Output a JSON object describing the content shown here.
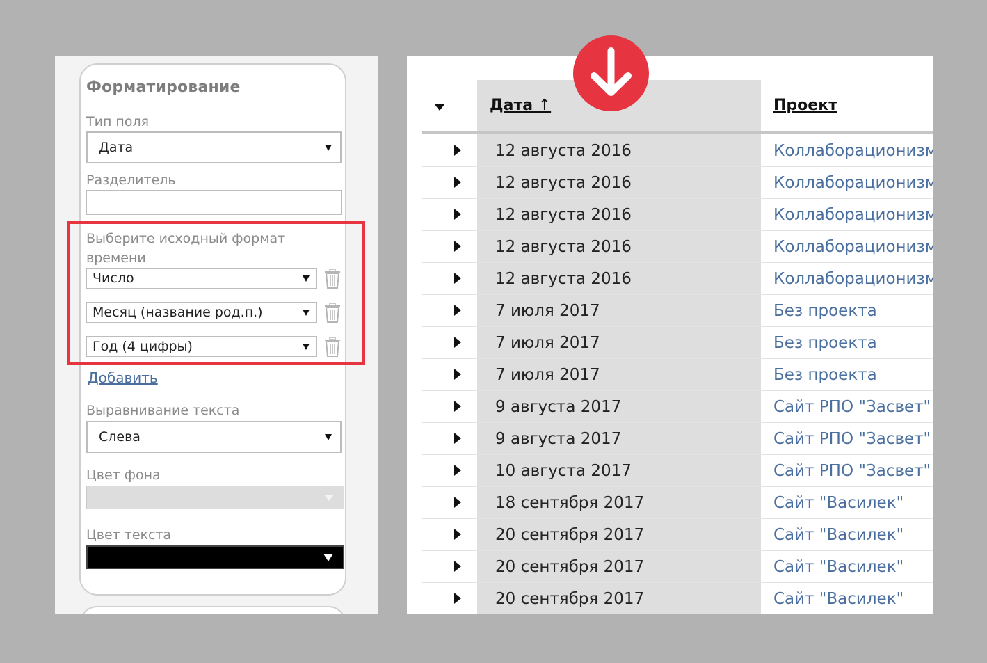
{
  "formatting": {
    "title": "Форматирование",
    "field_type": {
      "label": "Тип поля",
      "value": "Дата"
    },
    "separator": {
      "label": "Разделитель",
      "value": ""
    },
    "source_format": {
      "label_line1": "Выберите исходный формат",
      "label_line2": "времени",
      "parts": [
        {
          "value": "Число"
        },
        {
          "value": "Месяц (название род.п.)"
        },
        {
          "value": "Год (4 цифры)"
        }
      ]
    },
    "add_link": "Добавить",
    "text_align": {
      "label": "Выравнивание текста",
      "value": "Слева"
    },
    "bg_color": {
      "label": "Цвет фона",
      "value": "#dddddd"
    },
    "text_color": {
      "label": "Цвет текста",
      "value": "#000000"
    }
  },
  "table": {
    "columns": {
      "date": "Дата",
      "date_sort": "↑",
      "project": "Проект"
    },
    "rows": [
      {
        "date": "12 августа 2016",
        "project": "Коллаборационизм"
      },
      {
        "date": "12 августа 2016",
        "project": "Коллаборационизм"
      },
      {
        "date": "12 августа 2016",
        "project": "Коллаборационизм"
      },
      {
        "date": "12 августа 2016",
        "project": "Коллаборационизм"
      },
      {
        "date": "12 августа 2016",
        "project": "Коллаборационизм"
      },
      {
        "date": "7 июля 2017",
        "project": "Без проекта"
      },
      {
        "date": "7 июля 2017",
        "project": "Без проекта"
      },
      {
        "date": "7 июля 2017",
        "project": "Без проекта"
      },
      {
        "date": "9 августа 2017",
        "project": "Сайт РПО \"Засвет\""
      },
      {
        "date": "9 августа 2017",
        "project": "Сайт РПО \"Засвет\""
      },
      {
        "date": "10 августа 2017",
        "project": "Сайт РПО \"Засвет\""
      },
      {
        "date": "18 сентября 2017",
        "project": "Сайт \"Василек\""
      },
      {
        "date": "20 сентября 2017",
        "project": "Сайт \"Василек\""
      },
      {
        "date": "20 сентября 2017",
        "project": "Сайт \"Василек\""
      },
      {
        "date": "20 сентября 2017",
        "project": "Сайт \"Василек\""
      }
    ]
  },
  "colors": {
    "accent_red": "#e63440",
    "link_blue": "#4a6f9e",
    "date_column_bg": "#dedede"
  },
  "icons": {
    "badge": "arrow-down-icon",
    "remove": "trash-icon",
    "expander": "caret-right-icon",
    "select": "caret-down-icon"
  }
}
